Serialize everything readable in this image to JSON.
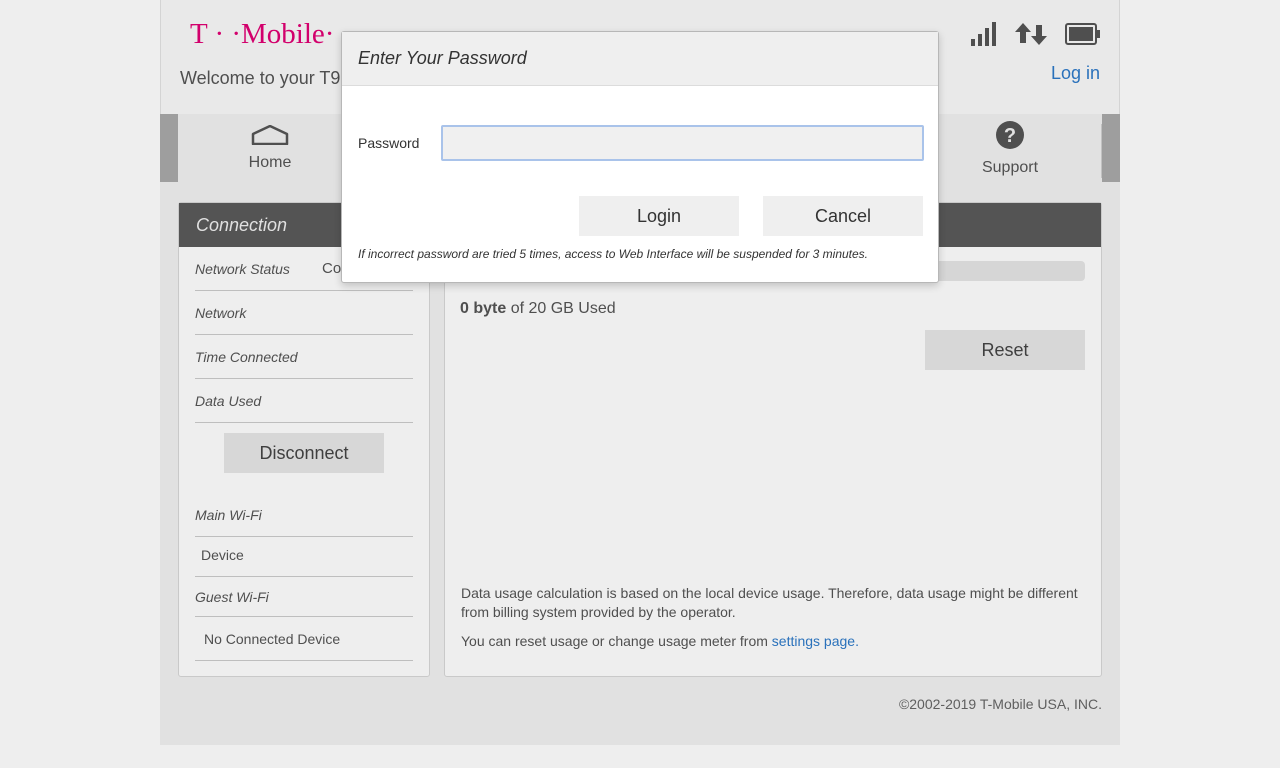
{
  "header": {
    "logo_text": "T · ·Mobile·",
    "welcome": "Welcome to your T9",
    "login_link": "Log in"
  },
  "nav": {
    "items": [
      {
        "label": "Home",
        "icon": "home-icon"
      },
      {
        "label": "Support",
        "icon": "question-icon"
      }
    ]
  },
  "connection": {
    "title": "Connection",
    "rows": [
      {
        "label": "Network Status",
        "value": "Co"
      },
      {
        "label": "Network",
        "value": ""
      },
      {
        "label": "Time Connected",
        "value": ""
      },
      {
        "label": "Data Used",
        "value": ""
      }
    ],
    "disconnect_label": "Disconnect",
    "main_wifi_label": "Main Wi-Fi",
    "main_wifi_device": "Device",
    "guest_wifi_label": "Guest Wi-Fi",
    "guest_wifi_device": "No Connected Device"
  },
  "usage": {
    "used_amount": "0 byte",
    "used_rest": " of 20 GB Used",
    "progress_fraction": 0,
    "reset_label": "Reset",
    "note": "Data usage calculation is based on the local device usage. Therefore, data usage might be different from billing system provided by the operator.",
    "reset_note_prefix": "You can reset usage or change usage meter from ",
    "settings_link": "settings page."
  },
  "footer": {
    "copyright": "©2002-2019 T-Mobile USA, INC."
  },
  "modal": {
    "title": "Enter Your Password",
    "password_label": "Password",
    "password_value": "",
    "login_label": "Login",
    "cancel_label": "Cancel",
    "warning": "If incorrect password are tried 5 times, access to Web Interface will be suspended for 3 minutes."
  },
  "colors": {
    "brand": "#e20074",
    "link": "#2d7ac9"
  }
}
